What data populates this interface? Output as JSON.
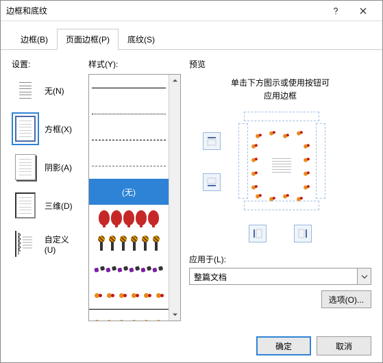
{
  "window": {
    "title": "边框和底纹"
  },
  "tabs": [
    {
      "label": "边框(B)"
    },
    {
      "label": "页面边框(P)"
    },
    {
      "label": "底纹(S)"
    }
  ],
  "settings": {
    "label": "设置:",
    "items": [
      {
        "label": "无(N)"
      },
      {
        "label": "方框(X)"
      },
      {
        "label": "阴影(A)"
      },
      {
        "label": "三维(D)"
      },
      {
        "label": "自定义(U)"
      }
    ]
  },
  "style": {
    "label": "样式(Y):",
    "none_label": "(无)"
  },
  "preview": {
    "label": "预览",
    "hint_line1": "单击下方图示或使用按钮可",
    "hint_line2": "应用边框"
  },
  "apply_to": {
    "label": "应用于(L):",
    "value": "整篇文档"
  },
  "options_btn": "选项(O)...",
  "buttons": {
    "ok": "确定",
    "cancel": "取消"
  }
}
